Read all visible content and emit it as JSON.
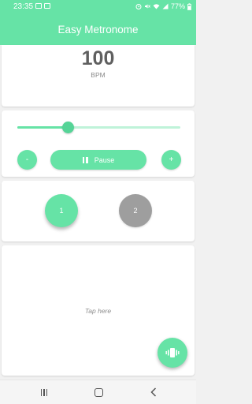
{
  "status_bar": {
    "time": "23:35",
    "battery": "77%"
  },
  "app_bar": {
    "title": "Easy Metronome"
  },
  "tempo": {
    "bpm": "100",
    "unit": "BPM",
    "slider_fraction": 0.31
  },
  "controls": {
    "decrease_label": "-",
    "pause_label": "Pause",
    "increase_label": "+"
  },
  "beats": [
    {
      "label": "1",
      "active": true
    },
    {
      "label": "2",
      "active": false
    }
  ],
  "tap_area": {
    "label": "Tap here"
  },
  "colors": {
    "accent": "#66e3a6",
    "accent_light": "#bff3d9",
    "inactive_beat": "#9e9e9e"
  },
  "icons": {
    "fab": "vibrate-icon",
    "pause": "pause-icon",
    "nav_recent": "recent-apps-icon",
    "nav_home": "home-icon",
    "nav_back": "back-icon"
  }
}
